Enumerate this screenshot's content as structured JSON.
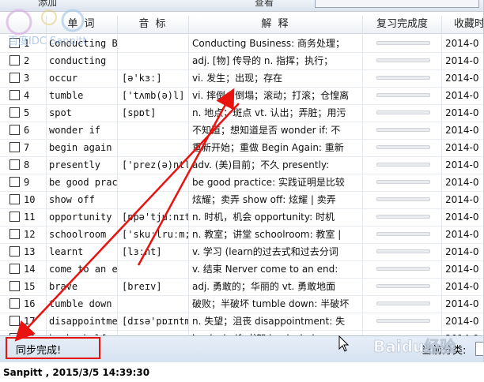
{
  "toolbar": {
    "left_text": "添加",
    "right_text": "查看"
  },
  "columns": {
    "word": "单 词",
    "phonetic": "音 标",
    "meaning": "解 释",
    "progress": "复习完成度",
    "collect": "收藏时"
  },
  "rows": [
    {
      "num": "1",
      "word": "Conducting B",
      "phon": "",
      "mean": "Conducting Business: 商务处理；",
      "date": "2014-0"
    },
    {
      "num": "2",
      "word": "conducting",
      "phon": "",
      "mean": "adj. [物] 传导的 n. 指挥；执行；",
      "date": "2014-0"
    },
    {
      "num": "3",
      "word": "occur",
      "phon": "[ə'kɜː]",
      "mean": "vi. 发生；出现；存在",
      "date": "2014-0"
    },
    {
      "num": "4",
      "word": "tumble",
      "phon": "['tʌmb(ə)l]",
      "mean": "vi. 摔倒；倒塌；滚动；打滚；仓惶离",
      "date": "2014-0"
    },
    {
      "num": "5",
      "word": "spot",
      "phon": "[spɒt]",
      "mean": "n. 地点；斑点 vt. 认出；弄脏；用污",
      "date": "2014-0"
    },
    {
      "num": "6",
      "word": "wonder if",
      "phon": "",
      "mean": "不知道；想知道是否 wonder if: 不",
      "date": "2014-0"
    },
    {
      "num": "7",
      "word": "begin again",
      "phon": "",
      "mean": "重新开始；重做 Begin Again: 重新",
      "date": "2014-0"
    },
    {
      "num": "8",
      "word": "presently",
      "phon": "['prez(ə)ntlɪ]",
      "mean": "adv. (美)目前；不久 presently:",
      "date": "2014-0"
    },
    {
      "num": "9",
      "word": "be good prac",
      "phon": "",
      "mean": "be good practice: 实践证明是比较",
      "date": "2014-0"
    },
    {
      "num": "10",
      "word": "show off",
      "phon": "",
      "mean": "炫耀；卖弄 show off: 炫耀 | 卖弄",
      "date": "2014-0"
    },
    {
      "num": "11",
      "word": "opportunity",
      "phon": "[ɒpə'tjuːnɪtɪ]",
      "mean": "n. 时机，机会 opportunity: 时机",
      "date": "2014-0"
    },
    {
      "num": "12",
      "word": "schoolroom",
      "phon": "['skuːlruːm;-",
      "mean": "n. 教室；讲堂 schoolroom: 教室 |",
      "date": "2014-0"
    },
    {
      "num": "13",
      "word": "learnt",
      "phon": "[lɜːnt]",
      "mean": "v. 学习 (learn的过去式和过去分词",
      "date": "2014-0"
    },
    {
      "num": "14",
      "word": "come to an e",
      "phon": "",
      "mean": "v. 结束 Nerver come to an end:",
      "date": "2014-0"
    },
    {
      "num": "15",
      "word": "brave",
      "phon": "[breɪv]",
      "mean": "adj. 勇敢的；华丽的 vt. 勇敢地面",
      "date": "2014-0"
    },
    {
      "num": "16",
      "word": "tumble down",
      "phon": "",
      "mean": "破败；半破坏 tumble down: 半破坏",
      "date": "2014-0"
    },
    {
      "num": "17",
      "word": "disappointme",
      "phon": "[dɪsə'pɒɪntm(ə)",
      "mean": "n. 失望；沮丧 disappointment: 失",
      "date": "2014-0"
    },
    {
      "num": "18",
      "word": "book shelf",
      "phon": "",
      "mean": "book shelf: 书架 book shelves",
      "date": "2014-0"
    }
  ],
  "status": {
    "message": "同步完成!",
    "category_label": "当前分类:"
  },
  "logo": {
    "text": "百度IDC Sanpitt"
  },
  "watermark": {
    "text": "Baidu经验"
  },
  "footer": {
    "caption": "Sanpitt , 2015/3/5 14:39:30"
  },
  "colors": {
    "annotation_red": "#e8120f",
    "status_bg": "#dce6f2"
  }
}
